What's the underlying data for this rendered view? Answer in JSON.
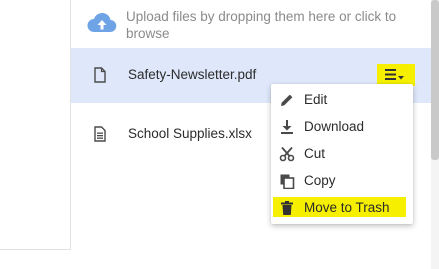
{
  "upload": {
    "text": "Upload files by dropping them here or click to browse",
    "icon": "cloud-upload-icon"
  },
  "files": [
    {
      "name": "Safety-Newsletter.pdf",
      "icon": "file-icon",
      "selected": true
    },
    {
      "name": "School Supplies.xlsx",
      "icon": "spreadsheet-icon",
      "selected": false
    }
  ],
  "row_menu": {
    "icon": "menu-dropdown-icon"
  },
  "context_menu": {
    "items": [
      {
        "label": "Edit",
        "icon": "pencil-icon"
      },
      {
        "label": "Download",
        "icon": "download-icon"
      },
      {
        "label": "Cut",
        "icon": "scissors-icon"
      },
      {
        "label": "Copy",
        "icon": "copy-icon"
      },
      {
        "label": "Move to Trash",
        "icon": "trash-icon",
        "highlighted": true
      }
    ]
  },
  "colors": {
    "selected_row": "#dfe8fb",
    "highlight": "#f6f000",
    "upload_icon": "#6ea3e6",
    "icon_dark": "#4a4a4a"
  }
}
